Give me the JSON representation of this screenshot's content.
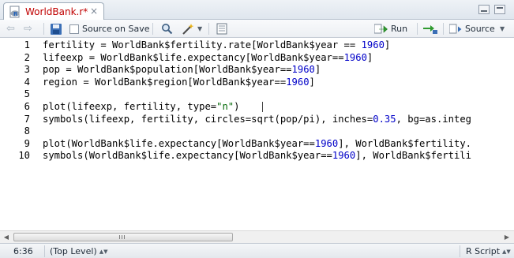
{
  "tab": {
    "label": "WorldBank.r*",
    "icon": "r-file-icon"
  },
  "toolbar": {
    "source_on_save_label": "Source on Save",
    "run_label": "Run",
    "source_label": "Source"
  },
  "lines": [
    {
      "num": "1",
      "code": [
        [
          "t",
          "fertility = WorldBank$fertility.rate[WorldBank$year == "
        ],
        [
          "n",
          "1960"
        ],
        [
          "t",
          "]"
        ]
      ]
    },
    {
      "num": "2",
      "code": [
        [
          "t",
          "lifeexp = WorldBank$life.expectancy[WorldBank$year=="
        ],
        [
          "n",
          "1960"
        ],
        [
          "t",
          "]"
        ]
      ]
    },
    {
      "num": "3",
      "code": [
        [
          "t",
          "pop = WorldBank$population[WorldBank$year=="
        ],
        [
          "n",
          "1960"
        ],
        [
          "t",
          "]"
        ]
      ]
    },
    {
      "num": "4",
      "code": [
        [
          "t",
          "region = WorldBank$region[WorldBank$year=="
        ],
        [
          "n",
          "1960"
        ],
        [
          "t",
          "]"
        ]
      ]
    },
    {
      "num": "5",
      "code": []
    },
    {
      "num": "6",
      "code": [
        [
          "t",
          "plot(lifeexp, fertility, type="
        ],
        [
          "s",
          "\"n\""
        ],
        [
          "t",
          ")"
        ]
      ]
    },
    {
      "num": "7",
      "code": [
        [
          "t",
          "symbols(lifeexp, fertility, circles=sqrt(pop/pi), inches="
        ],
        [
          "n",
          "0.35"
        ],
        [
          "t",
          ", bg=as.integ"
        ]
      ]
    },
    {
      "num": "8",
      "code": []
    },
    {
      "num": "9",
      "code": [
        [
          "t",
          "plot(WorldBank$life.expectancy[WorldBank$year=="
        ],
        [
          "n",
          "1960"
        ],
        [
          "t",
          "], WorldBank$fertility."
        ]
      ]
    },
    {
      "num": "10",
      "code": [
        [
          "t",
          "symbols(WorldBank$life.expectancy[WorldBank$year=="
        ],
        [
          "n",
          "1960"
        ],
        [
          "t",
          "], WorldBank$fertili"
        ]
      ]
    }
  ],
  "status": {
    "position": "6:36",
    "scope": "(Top Level)",
    "filetype": "R Script"
  },
  "colors": {
    "number": "#0000c8",
    "string": "#036a07",
    "tab_label": "#c00000"
  }
}
